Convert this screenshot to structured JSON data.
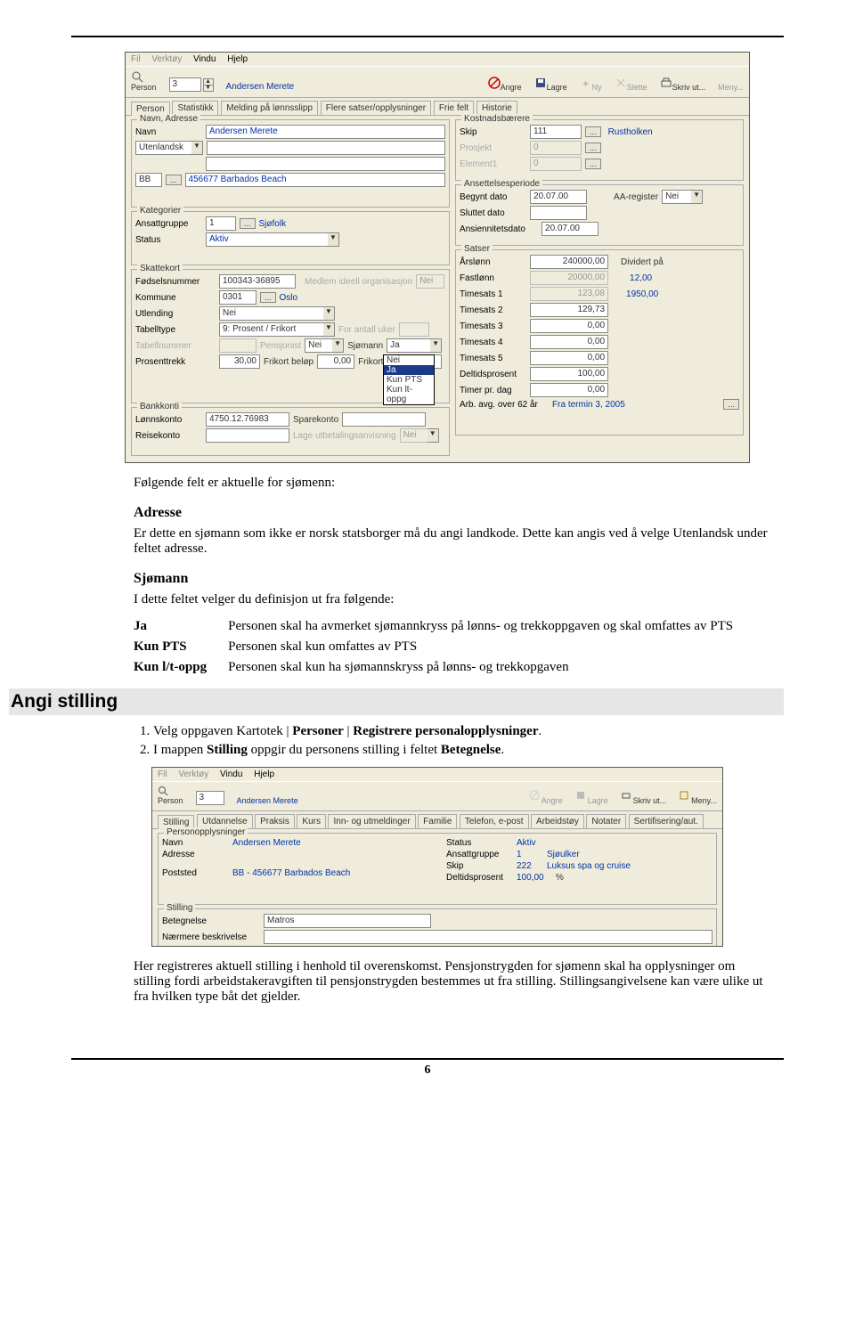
{
  "page_number": "6",
  "section_heading": "Angi stilling",
  "app1": {
    "menubar": {
      "fil": "Fil",
      "verktoy": "Verktøy",
      "vindu": "Vindu",
      "hjelp": "Hjelp"
    },
    "toolbar": {
      "person_label": "Person",
      "person_value": "3",
      "name": "Andersen Merete",
      "angre": "Angre",
      "lagre": "Lagre",
      "ny": "Ny",
      "slette": "Slette",
      "skrivut": "Skriv ut...",
      "meny": "Meny..."
    },
    "tabs": [
      "Person",
      "Statistikk",
      "Melding på lønnsslipp",
      "Flere satser/opplysninger",
      "Frie felt",
      "Historie"
    ],
    "na_title": "Navn, Adresse",
    "navn_label": "Navn",
    "navn_value": "Andersen Merete",
    "adresse_combo": "Utenlandsk",
    "land_code": "BB",
    "land_desc": "456677 Barbados Beach",
    "kategorier": "Kategorier",
    "ansattgruppe_label": "Ansattgruppe",
    "ansattgruppe_value": "1",
    "ansattgruppe_desc": "Sjøfolk",
    "status_label": "Status",
    "status_value": "Aktiv",
    "sk_title": "Skattekort",
    "fnr_label": "Fødselsnummer",
    "fnr_value": "100343-36895",
    "medlem_label": "Medlem ideell organisasjon",
    "medlem_value": "Nei",
    "kommune_label": "Kommune",
    "kommune_code": "0301",
    "kommune_name": "Oslo",
    "utlending_label": "Utlending",
    "utlending_value": "Nei",
    "tabelltype_label": "Tabelltype",
    "tabelltype_value": "9: Prosent / Frikort",
    "forantall_label": "For antall uker",
    "tabellnummer_label": "Tabellnummer",
    "pensjonist_label": "Pensjonist",
    "pensjonist_value": "Nei",
    "sjomann_label": "Sjømann",
    "sjomann_value": "Ja",
    "sjomann_options": [
      "Nei",
      "Ja",
      "Kun PTS",
      "Kun lt-oppg"
    ],
    "prosenttrekk_label": "Prosenttrekk",
    "prosenttrekk_value": "30,00",
    "frikortbelop_label": "Frikort beløp",
    "frikortbelop_value": "0,00",
    "frikortrest_label": "Frikort rest",
    "bk_title": "Bankkonti",
    "lonnskonto_label": "Lønnskonto",
    "lonnskonto_value": "4750.12.76983",
    "sparekonto_label": "Sparekonto",
    "reisekonto_label": "Reisekonto",
    "lageutb_label": "Lage utbetalingsanvisning",
    "lageutb_value": "Nei",
    "kb_title": "Kostnadsbærere",
    "skip_label": "Skip",
    "skip_value": "111",
    "skip_name": "Rustholken",
    "prosjekt_label": "Prosjekt",
    "prosjekt_value": "0",
    "element1_label": "Element1",
    "element1_value": "0",
    "ap_title": "Ansettelsesperiode",
    "begynt_label": "Begynt dato",
    "begynt_value": "20.07.00",
    "aareg_label": "AA-register",
    "aareg_value": "Nei",
    "sluttet_label": "Sluttet dato",
    "ansdato_label": "Ansiennitetsdato",
    "ansdato_value": "20.07.00",
    "sat_title": "Satser",
    "arslonn_label": "Årslønn",
    "arslonn_value": "240000,00",
    "dividert_label": "Dividert på",
    "fastlonn_label": "Fastlønn",
    "fastlonn_value": "20000,00",
    "fastlonn_div": "12,00",
    "t1_label": "Timesats 1",
    "t1_value": "123,08",
    "t1_div": "1950,00",
    "t2_label": "Timesats 2",
    "t2_value": "129,73",
    "t3_label": "Timesats 3",
    "t3_value": "0,00",
    "t4_label": "Timesats 4",
    "t4_value": "0,00",
    "t5_label": "Timesats 5",
    "t5_value": "0,00",
    "deltid_label": "Deltidsprosent",
    "deltid_value": "100,00",
    "timer_label": "Timer pr. dag",
    "timer_value": "0,00",
    "arb62_label": "Arb. avg. over 62 år",
    "arb62_value": "Fra termin 3, 2005"
  },
  "text1": {
    "intro": "Følgende felt er aktuelle for sjømenn:",
    "adresse_h": "Adresse",
    "adresse_p": "Er dette en sjømann som ikke er norsk statsborger må du angi landkode. Dette kan angis ved å velge Utenlandsk under feltet adresse.",
    "sjomann_h": "Sjømann",
    "sjomann_p": "I dette feltet velger du definisjon ut fra følgende:",
    "row_ja_k": "Ja",
    "row_ja_v": "Personen skal ha avmerket sjømannkryss på lønns- og trekkoppgaven og skal omfattes av PTS",
    "row_pts_k": "Kun PTS",
    "row_pts_v": "Personen skal kun omfattes av PTS",
    "row_lt_k": "Kun l/t-oppg",
    "row_lt_v": "Personen skal kun ha sjømannskryss på lønns- og trekkopgaven"
  },
  "steps": {
    "s1_pre": "Velg oppgaven Kartotek | ",
    "s1_b1": "Personer",
    "s1_mid": " | ",
    "s1_b2": "Registrere personalopplysninger",
    "s1_post": ".",
    "s2_pre": "I mappen ",
    "s2_b1": "Stilling",
    "s2_mid": " oppgir du personens stilling i feltet ",
    "s2_b2": "Betegnelse",
    "s2_post": "."
  },
  "app2": {
    "menubar": {
      "fil": "Fil",
      "verktoy": "Verktøy",
      "vindu": "Vindu",
      "hjelp": "Hjelp"
    },
    "toolbar": {
      "person_label": "Person",
      "person_value": "3",
      "name": "Andersen Merete",
      "angre": "Angre",
      "lagre": "Lagre",
      "skrivut": "Skriv ut...",
      "meny": "Meny..."
    },
    "tabs": [
      "Stilling",
      "Utdannelse",
      "Praksis",
      "Kurs",
      "Inn- og utmeldinger",
      "Familie",
      "Telefon, e-post",
      "Arbeidstøy",
      "Notater",
      "Sertifisering/aut."
    ],
    "po_title": "Personopplysninger",
    "navn_label": "Navn",
    "navn_value": "Andersen Merete",
    "adresse_label": "Adresse",
    "poststed_label": "Poststed",
    "poststed_value": "BB - 456677 Barbados Beach",
    "status_label": "Status",
    "status_value": "Aktiv",
    "ansgrp_label": "Ansattgruppe",
    "ansgrp_code": "1",
    "ansgrp_name": "Sjøulker",
    "skip_label": "Skip",
    "skip_code": "222",
    "skip_name": "Luksus spa og cruise",
    "deltid_label": "Deltidsprosent",
    "deltid_value": "100,00",
    "deltid_unit": "%",
    "st_title": "Stilling",
    "bet_label": "Betegnelse",
    "bet_value": "Matros",
    "nb_label": "Nærmere beskrivelse"
  },
  "text2": {
    "para": "Her registreres aktuell stilling i henhold til overenskomst. Pensjonstrygden for sjømenn skal ha opplysninger om stilling fordi arbeidstakeravgiften til pensjonstrygden bestemmes ut fra stilling. Stillingsangivelsene kan være ulike ut fra hvilken type båt det gjelder."
  }
}
